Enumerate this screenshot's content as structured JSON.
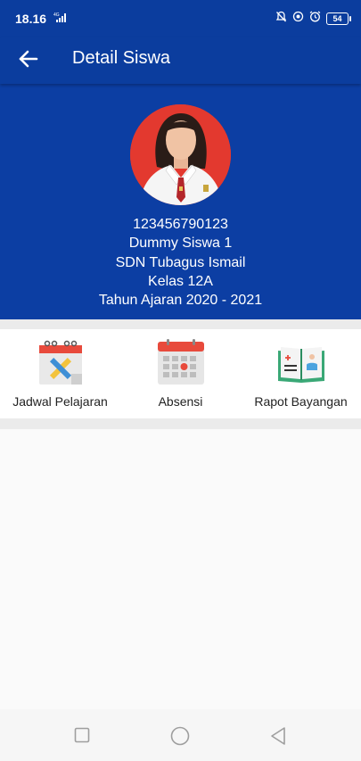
{
  "status_bar": {
    "time": "18.16",
    "network": "4G",
    "battery": "54"
  },
  "app_bar": {
    "title": "Detail Siswa",
    "back_icon": "arrow-left-icon"
  },
  "student": {
    "nisn": "123456790123",
    "name": "Dummy Siswa 1",
    "school": "SDN Tubagus Ismail",
    "class": "Kelas 12A",
    "academic_year": "Tahun Ajaran 2020 - 2021"
  },
  "menu": [
    {
      "label": "Jadwal Pelajaran",
      "icon": "schedule-calendar-icon"
    },
    {
      "label": "Absensi",
      "icon": "attendance-calendar-icon"
    },
    {
      "label": "Rapot Bayangan",
      "icon": "report-book-icon"
    }
  ],
  "nav_bar": {
    "recent_icon": "square-icon",
    "home_icon": "circle-icon",
    "back_icon": "triangle-back-icon"
  },
  "colors": {
    "primary": "#0b3d9e",
    "profile_bg": "#0c3ea3",
    "avatar_bg": "#e3392f"
  }
}
